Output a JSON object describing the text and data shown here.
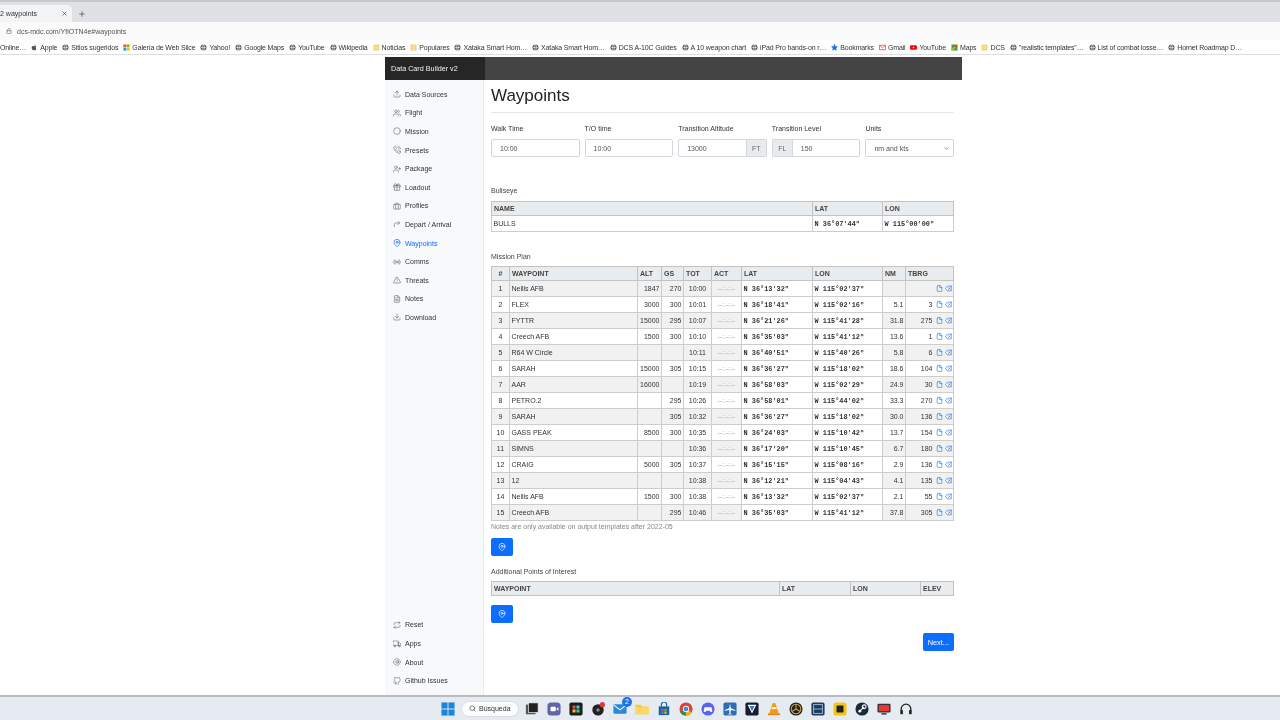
{
  "browser": {
    "tab": {
      "title": "2 waypoints"
    },
    "url": "dcs-mdc.com/YfiOTN4e#waypoints",
    "bookmarks": [
      "Online…",
      "Apple",
      "Sitios sugeridos",
      "Galería de Web Slice",
      "Yahoo!",
      "Google Maps",
      "YouTube",
      "Wikipedia",
      "Noticias",
      "Populares",
      "Xataka Smart Hom…",
      "Xataka Smart Hom…",
      "DCS A-10C Guides",
      "A 10 weapon chart",
      "iPad Pro hands-on r…",
      "Bookmarks",
      "Gmail",
      "YouTube",
      "Maps",
      "DCS",
      "\"realistic templates\"…",
      "List of combat losse…",
      "Hornet Roadmap D…"
    ]
  },
  "header": {
    "brand": "Data Card Builder v2"
  },
  "sidebar": {
    "items": [
      {
        "label": "Data Sources",
        "selected": false
      },
      {
        "label": "Flight",
        "selected": false
      },
      {
        "label": "Mission",
        "selected": false
      },
      {
        "label": "Presets",
        "selected": false
      },
      {
        "label": "Package",
        "selected": false
      },
      {
        "label": "Loadout",
        "selected": false
      },
      {
        "label": "Profiles",
        "selected": false
      },
      {
        "label": "Depart / Arrival",
        "selected": false
      },
      {
        "label": "Waypoints",
        "selected": true
      },
      {
        "label": "Comms",
        "selected": false
      },
      {
        "label": "Threats",
        "selected": false
      },
      {
        "label": "Notes",
        "selected": false
      },
      {
        "label": "Download",
        "selected": false
      }
    ],
    "footer_items": [
      "Reset",
      "Apps",
      "About",
      "Github Issues"
    ]
  },
  "page": {
    "title": "Waypoints",
    "fields": [
      {
        "kind": "input",
        "label": "Walk Time",
        "value": "10:00"
      },
      {
        "kind": "input",
        "label": "T/O time",
        "value": "10:00"
      },
      {
        "kind": "input",
        "label": "Transition Altitude",
        "value": "13000",
        "suffix": "FT"
      },
      {
        "kind": "input",
        "label": "Transition Level",
        "prefix": "FL",
        "value": "150"
      },
      {
        "kind": "select",
        "label": "Units",
        "value": "nm and kts"
      }
    ]
  },
  "bullseye": {
    "title": "Bullseye",
    "columns": [
      "NAME",
      "LAT",
      "LON"
    ],
    "rows": [
      {
        "name": "BULLS",
        "lat": "N 36°07'44\"",
        "lon": "W 115°00'00\""
      }
    ]
  },
  "mission_plan": {
    "title": "Mission Plan",
    "columns": [
      "#",
      "WAYPOINT",
      "ALT",
      "GS",
      "TOT",
      "ACT",
      "LAT",
      "LON",
      "NM",
      "TBRG"
    ],
    "rows": [
      {
        "num": "1",
        "waypoint": "Nellis AFB",
        "alt": "1847",
        "gs": "270",
        "tot": "10:00",
        "act": "--:--:--",
        "lat": "N 36°13'32\"",
        "lon": "W 115°02'37\""
      },
      {
        "num": "2",
        "waypoint": "FLEX",
        "alt": "3000",
        "gs": "300",
        "tot": "10:01",
        "act": "--:--:--",
        "lat": "N 36°18'41\"",
        "lon": "W 115°02'16\"",
        "nm": "5.1",
        "tbrg": "3"
      },
      {
        "num": "3",
        "waypoint": "FYTTR",
        "alt": "15000",
        "gs": "295",
        "tot": "10:07",
        "act": "--:--:--",
        "lat": "N 36°21'26\"",
        "lon": "W 115°41'28\"",
        "nm": "31.8",
        "tbrg": "275"
      },
      {
        "num": "4",
        "waypoint": "Creech AFB",
        "alt": "1500",
        "gs": "300",
        "tot": "10:10",
        "act": "--:--:--",
        "lat": "N 36°35'03\"",
        "lon": "W 115°41'12\"",
        "nm": "13.6",
        "tbrg": "1"
      },
      {
        "num": "5",
        "waypoint": "R64 W Circle",
        "tot": "10:11",
        "act": "--:--:--",
        "lat": "N 36°40'51\"",
        "lon": "W 115°40'26\"",
        "nm": "5.8",
        "tbrg": "6"
      },
      {
        "num": "6",
        "waypoint": "SARAH",
        "alt": "15000",
        "gs": "305",
        "tot": "10:15",
        "act": "--:--:--",
        "lat": "N 36°36'27\"",
        "lon": "W 115°18'02\"",
        "nm": "18.6",
        "tbrg": "104"
      },
      {
        "num": "7",
        "waypoint": "AAR",
        "alt": "16000",
        "tot": "10:19",
        "act": "--:--:--",
        "lat": "N 36°58'03\"",
        "lon": "W 115°02'29\"",
        "nm": "24.9",
        "tbrg": "30"
      },
      {
        "num": "8",
        "waypoint": "PETRO.2",
        "gs": "295",
        "tot": "10:26",
        "act": "--:--:--",
        "lat": "N 36°58'01\"",
        "lon": "W 115°44'02\"",
        "nm": "33.3",
        "tbrg": "270"
      },
      {
        "num": "9",
        "waypoint": "SARAH",
        "gs": "305",
        "tot": "10:32",
        "act": "--:--:--",
        "lat": "N 36°36'27\"",
        "lon": "W 115°18'02\"",
        "nm": "30.0",
        "tbrg": "136"
      },
      {
        "num": "10",
        "waypoint": "GASS PEAK",
        "alt": "8500",
        "gs": "300",
        "tot": "10:35",
        "act": "--:--:--",
        "lat": "N 36°24'03\"",
        "lon": "W 115°10'42\"",
        "nm": "13.7",
        "tbrg": "154"
      },
      {
        "num": "11",
        "waypoint": "SIMNS",
        "tot": "10:36",
        "act": "--:--:--",
        "lat": "N 36°17'20\"",
        "lon": "W 115°10'45\"",
        "nm": "6.7",
        "tbrg": "180"
      },
      {
        "num": "12",
        "waypoint": "CRAIG",
        "alt": "5000",
        "gs": "305",
        "tot": "10:37",
        "act": "--:--:--",
        "lat": "N 36°15'15\"",
        "lon": "W 115°08'16\"",
        "nm": "2.9",
        "tbrg": "136"
      },
      {
        "num": "13",
        "waypoint": "12",
        "tot": "10:38",
        "act": "--:--:--",
        "lat": "N 36°12'21\"",
        "lon": "W 115°04'43\"",
        "nm": "4.1",
        "tbrg": "135"
      },
      {
        "num": "14",
        "waypoint": "Nellis AFB",
        "alt": "1500",
        "gs": "300",
        "tot": "10:38",
        "act": "--:--:--",
        "lat": "N 36°13'32\"",
        "lon": "W 115°02'37\"",
        "nm": "2.1",
        "tbrg": "55"
      },
      {
        "num": "15",
        "waypoint": "Creech AFB",
        "gs": "295",
        "tot": "10:46",
        "act": "--:--:--",
        "lat": "N 36°35'03\"",
        "lon": "W 115°41'12\"",
        "nm": "37.8",
        "tbrg": "305"
      }
    ],
    "note": "Notes are only available on output templates after 2022-05"
  },
  "points_of_interest": {
    "title": "Additional Points of Interest",
    "columns": [
      "WAYPOINT",
      "LAT",
      "LON",
      "ELEV"
    ]
  },
  "next_button": "Next...",
  "taskbar": {
    "search": "Búsqueda",
    "mail_badge": "2"
  }
}
